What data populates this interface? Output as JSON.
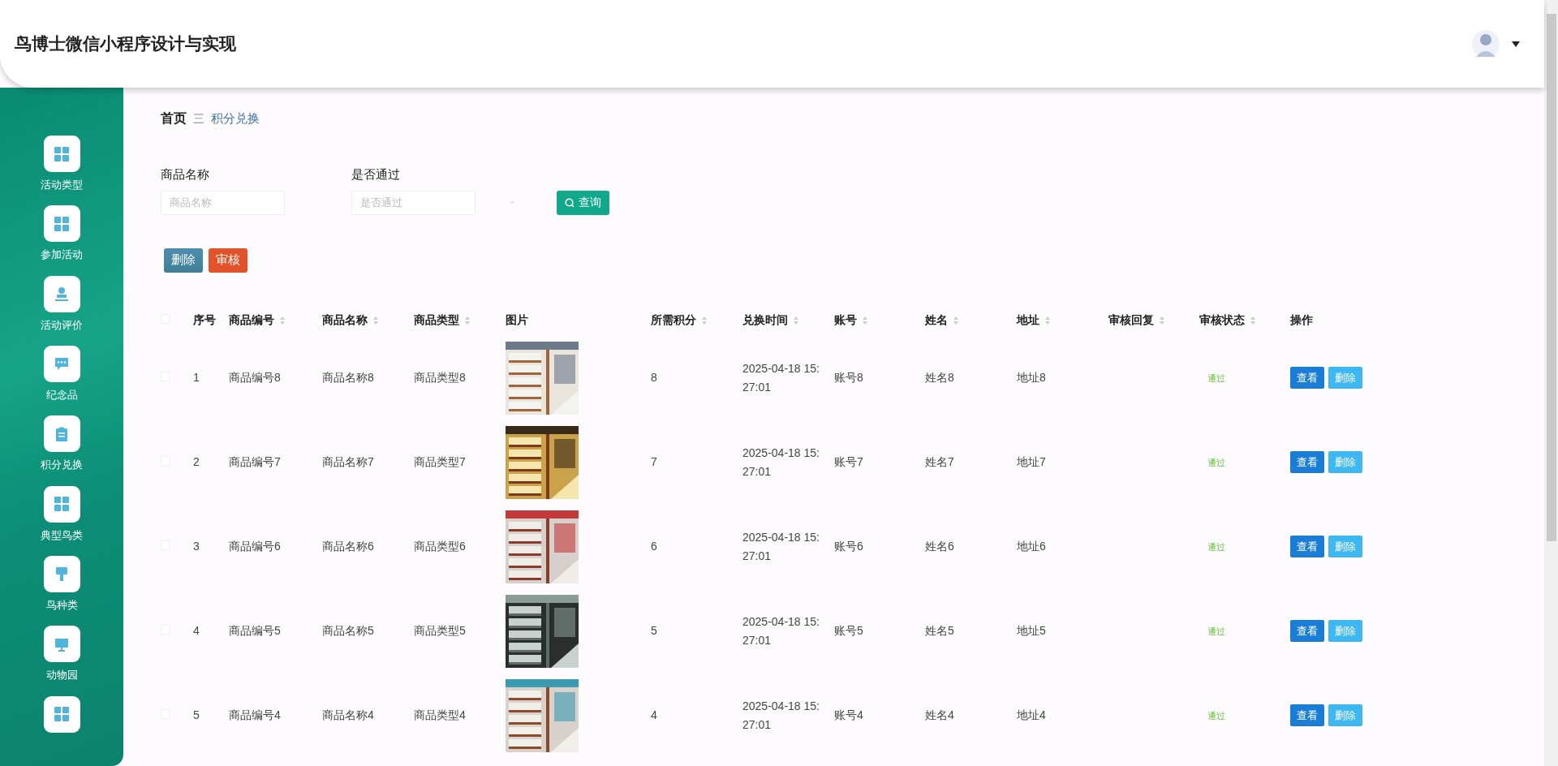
{
  "header": {
    "title": "鸟博士微信小程序设计与实现"
  },
  "sidebar": {
    "items": [
      {
        "kind": "grid",
        "label": "活动类型"
      },
      {
        "kind": "grid",
        "label": "参加活动"
      },
      {
        "kind": "person",
        "label": "活动评价"
      },
      {
        "kind": "chat",
        "label": "纪念品"
      },
      {
        "kind": "clipboard",
        "label": "积分兑换"
      },
      {
        "kind": "grid",
        "label": "典型鸟类"
      },
      {
        "kind": "brush",
        "label": "鸟种类"
      },
      {
        "kind": "monitor",
        "label": "动物园"
      },
      {
        "kind": "grid"
      }
    ]
  },
  "breadcrumb": {
    "home": "首页",
    "separator": "三",
    "current": "积分兑换"
  },
  "search": {
    "fields": [
      {
        "label": "商品名称",
        "placeholder": "商品名称",
        "kind": "input"
      },
      {
        "label": "是否通过",
        "placeholder": "是否通过",
        "kind": "select"
      }
    ],
    "button": "查询"
  },
  "actions": [
    {
      "label": "删除",
      "kind": "delete"
    },
    {
      "label": "审核",
      "kind": "review"
    }
  ],
  "table": {
    "select_all": {
      "checked": false
    },
    "columns": [
      {
        "label": "序号",
        "sortable": false
      },
      {
        "label": "商品编号",
        "sortable": true
      },
      {
        "label": "商品名称",
        "sortable": true
      },
      {
        "label": "商品类型",
        "sortable": true
      },
      {
        "label": "图片",
        "sortable": false,
        "kind": "picture"
      },
      {
        "label": "所需积分",
        "sortable": true
      },
      {
        "label": "兑换时间",
        "sortable": true
      },
      {
        "label": "账号",
        "sortable": true
      },
      {
        "label": "姓名",
        "sortable": true
      },
      {
        "label": "地址",
        "sortable": true
      },
      {
        "label": "审核回复",
        "sortable": true
      },
      {
        "label": "审核状态",
        "sortable": true
      },
      {
        "label": "操作",
        "sortable": false
      }
    ],
    "rows": [
      {
        "checked": false,
        "cells": [
          "1",
          "商品编号8",
          "商品名称8",
          "商品类型8",
          "",
          "8",
          "2025-04-18 15:27:01",
          "账号8",
          "姓名8",
          "地址8",
          ""
        ],
        "status": "通过",
        "buttons": [
          "查看",
          "删除"
        ]
      },
      {
        "checked": false,
        "cells": [
          "2",
          "商品编号7",
          "商品名称7",
          "商品类型7",
          "",
          "7",
          "2025-04-18 15:27:01",
          "账号7",
          "姓名7",
          "地址7",
          ""
        ],
        "status": "通过",
        "buttons": [
          "查看",
          "删除"
        ]
      },
      {
        "checked": false,
        "cells": [
          "3",
          "商品编号6",
          "商品名称6",
          "商品类型6",
          "",
          "6",
          "2025-04-18 15:27:01",
          "账号6",
          "姓名6",
          "地址6",
          ""
        ],
        "status": "通过",
        "buttons": [
          "查看",
          "删除"
        ]
      },
      {
        "checked": false,
        "cells": [
          "4",
          "商品编号5",
          "商品名称5",
          "商品类型5",
          "",
          "5",
          "2025-04-18 15:27:01",
          "账号5",
          "姓名5",
          "地址5",
          ""
        ],
        "status": "通过",
        "buttons": [
          "查看",
          "删除"
        ]
      },
      {
        "checked": false,
        "cells": [
          "5",
          "商品编号4",
          "商品名称4",
          "商品类型4",
          "",
          "4",
          "2025-04-18 15:27:01",
          "账号4",
          "姓名4",
          "地址4",
          ""
        ],
        "status": "通过",
        "buttons": [
          "查看",
          "删除"
        ]
      }
    ]
  }
}
